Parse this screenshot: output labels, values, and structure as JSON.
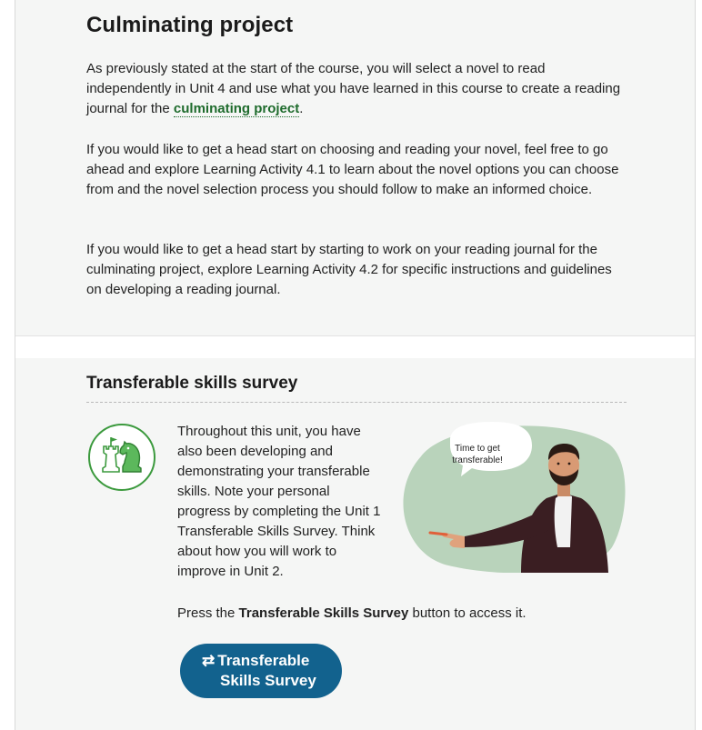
{
  "culminating": {
    "title": "Culminating project",
    "p1_before": "As previously stated at the start of the course, you will select a novel to read independently in Unit 4 and use what you have learned in this course to create a reading journal for the ",
    "p1_link": "culminating project",
    "p1_after": ".",
    "p2": "If you would like to get a head start on choosing and reading your novel, feel free to go ahead and explore Learning Activity 4.1 to learn about the novel options you can choose from and the novel selection process you should follow to make an informed choice.",
    "p3": "If you would like to get a head start by starting to work on your reading journal for the culminating project, explore Learning Activity 4.2 for specific instructions and guidelines on developing a reading journal."
  },
  "survey": {
    "title": "Transferable skills survey",
    "body": "Throughout this unit, you have also been developing and demonstrating your transferable skills. Note your personal progress by completing the Unit 1 Transferable Skills Survey. Think about how you will work to improve in Unit 2.",
    "press_before": "Press the ",
    "press_bold": "Transferable Skills Survey",
    "press_after": " button to access it.",
    "bubble_line1": "Time to get",
    "bubble_line2": "transferable!",
    "button_line1": "Transferable",
    "button_line2": "Skills Survey",
    "button_icon": "exchange-arrows-icon",
    "icon": "chess-pieces-icon"
  },
  "colors": {
    "link": "#1e6b2c",
    "button": "#12628e",
    "badge_green": "#3c9a3e",
    "illustration_bg": "#b9d3bb"
  }
}
